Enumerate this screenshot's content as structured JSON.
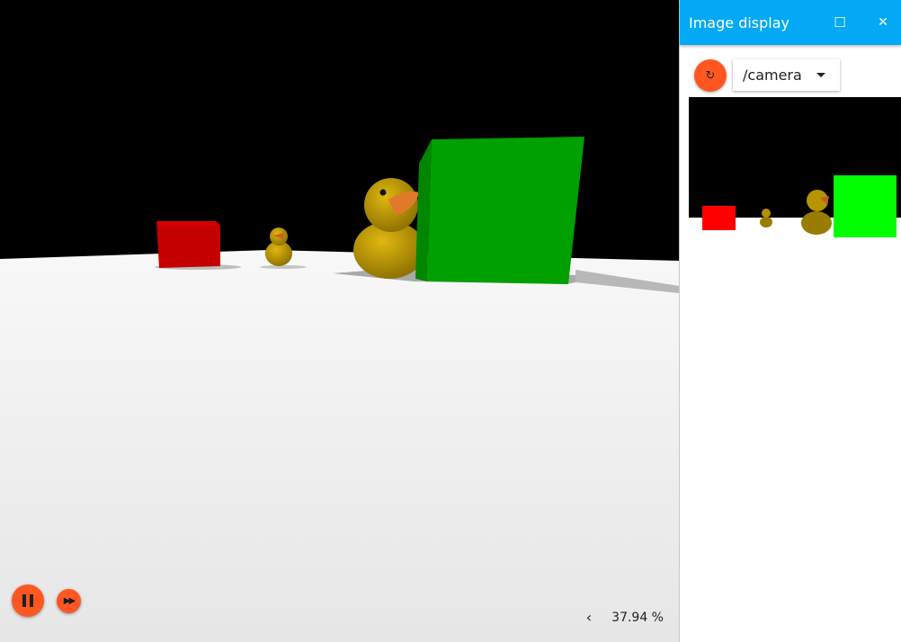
{
  "scene": {
    "sky_color": "#000000",
    "floor_color": "#eeeeee",
    "objects": [
      "red-box",
      "small-duck",
      "large-duck",
      "green-box"
    ],
    "controls": {
      "pause_icon": "pause-icon",
      "fast_forward_icon": "fast-forward-icon"
    },
    "rtf": {
      "chevron": "‹",
      "value": "37.94 %"
    }
  },
  "panel": {
    "title": "Image display",
    "maximize_icon": "☐",
    "close_icon": "✕",
    "refresh_icon": "↻",
    "topic": "/camera"
  },
  "colors": {
    "accent": "#ff5722",
    "header": "#03a9f4",
    "green_box": "#00a000",
    "red_box": "#cc0000",
    "duck": "#c8a000"
  }
}
